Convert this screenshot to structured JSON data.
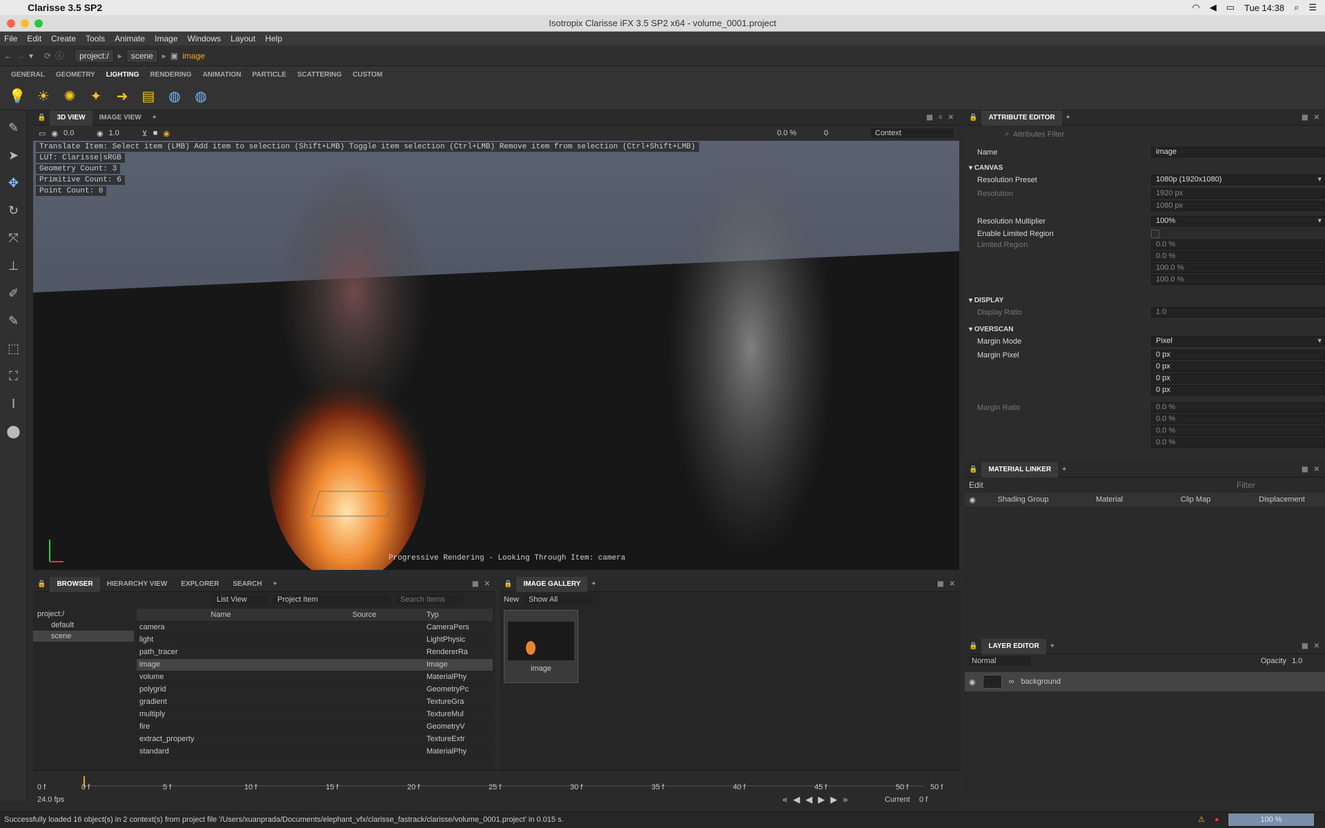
{
  "mac": {
    "app": "Clarisse 3.5 SP2",
    "clock": "Tue 14:38"
  },
  "window_title": "Isotropix Clarisse iFX 3.5 SP2 x64  - volume_0001.project",
  "menu": [
    "File",
    "Edit",
    "Create",
    "Tools",
    "Animate",
    "Image",
    "Windows",
    "Layout",
    "Help"
  ],
  "path": {
    "root": "project:/",
    "scene": "scene",
    "item": "image"
  },
  "shelf_tabs": [
    "GENERAL",
    "GEOMETRY",
    "LIGHTING",
    "RENDERING",
    "ANIMATION",
    "PARTICLE",
    "SCATTERING",
    "CUSTOM"
  ],
  "shelf_active": "LIGHTING",
  "viewport": {
    "tabs": [
      "3D VIEW",
      "IMAGE VIEW"
    ],
    "scale": "0.0",
    "mult": "1.0",
    "percent": "0.0 %",
    "frame": "0",
    "context": "Context",
    "overlay": [
      "Translate Item: Select item (LMB)  Add item to selection (Shift+LMB)  Toggle item selection (Ctrl+LMB)  Remove item from selection (Ctrl+Shift+LMB)",
      "LUT: Clarisse|sRGB",
      "Geometry Count: 3",
      "Primitive Count: 6",
      "Point Count: 0"
    ],
    "footer": "Progressive Rendering - Looking Through Item: camera"
  },
  "attr_editor": {
    "title": "ATTRIBUTE EDITOR",
    "filter_placeholder": "Attributes Filter",
    "name_label": "Name",
    "name_value": "image",
    "canvas": "CANVAS",
    "res_preset_label": "Resolution Preset",
    "res_preset": "1080p (1920x1080)",
    "res_label": "Resolution",
    "res_w": "1920 px",
    "res_h": "1080 px",
    "res_mult_label": "Resolution Multiplier",
    "res_mult": "100%",
    "limited_label": "Enable Limited Region",
    "limited_region_label": "Limited Region",
    "lr": [
      "0.0 %",
      "0.0 %",
      "100.0 %",
      "100.0 %"
    ],
    "display": "DISPLAY",
    "display_ratio_label": "Display Ratio",
    "display_ratio": "1.0",
    "overscan": "OVERSCAN",
    "margin_mode_label": "Margin Mode",
    "margin_mode": "Pixel",
    "margin_pixel_label": "Margin Pixel",
    "mp": [
      "0 px",
      "0 px",
      "0 px",
      "0 px"
    ],
    "margin_ratio_label": "Margin Ratio",
    "mr": [
      "0.0 %",
      "0.0 %",
      "0.0 %",
      "0.0 %"
    ]
  },
  "material_linker": {
    "title": "MATERIAL LINKER",
    "edit": "Edit",
    "filter": "Filter",
    "cols": [
      "Shading Group",
      "Material",
      "Clip Map",
      "Displacement"
    ]
  },
  "layer_editor": {
    "title": "LAYER EDITOR",
    "blend": "Normal",
    "opacity_label": "Opacity",
    "opacity": "1.0",
    "layer": "background"
  },
  "browser": {
    "tabs": [
      "BROWSER",
      "HIERARCHY VIEW",
      "EXPLORER",
      "SEARCH"
    ],
    "view": "List View",
    "filter": "Project Item",
    "search": "Search Items",
    "tree": [
      "project:/",
      "default",
      "scene"
    ],
    "cols": [
      "Name",
      "Source",
      "Typ"
    ],
    "rows": [
      {
        "n": "camera",
        "t": "CameraPers"
      },
      {
        "n": "light",
        "t": "LightPhysic"
      },
      {
        "n": "path_tracer",
        "t": "RendererRa"
      },
      {
        "n": "image",
        "t": "Image"
      },
      {
        "n": "volume",
        "t": "MaterialPhy"
      },
      {
        "n": "polygrid",
        "t": "GeometryPc"
      },
      {
        "n": "gradient",
        "t": "TextureGra"
      },
      {
        "n": "multiply",
        "t": "TextureMul"
      },
      {
        "n": "fire",
        "t": "GeometryV"
      },
      {
        "n": "extract_property",
        "t": "TextureExtr"
      },
      {
        "n": "standard",
        "t": "MaterialPhy"
      }
    ]
  },
  "gallery": {
    "title": "IMAGE GALLERY",
    "new": "New",
    "show": "Show All",
    "thumb": "image"
  },
  "timeline": {
    "start": "0 f",
    "end": "50 f",
    "end2": "50 f",
    "fps": "24.0 fps",
    "current_label": "Current",
    "current": "0 f",
    "cursor_label": "0 f",
    "ticks": [
      "5 f",
      "10 f",
      "15 f",
      "20 f",
      "25 f",
      "30 f",
      "35 f",
      "40 f",
      "45 f",
      "50 f"
    ]
  },
  "status": "Successfully loaded 16 object(s) in 2 context(s) from project file '/Users/xuanprada/Documents/elephant_vfx/clarisse_fastrack/clarisse/volume_0001.project' in 0.015 s.",
  "status_zoom": "100 %"
}
